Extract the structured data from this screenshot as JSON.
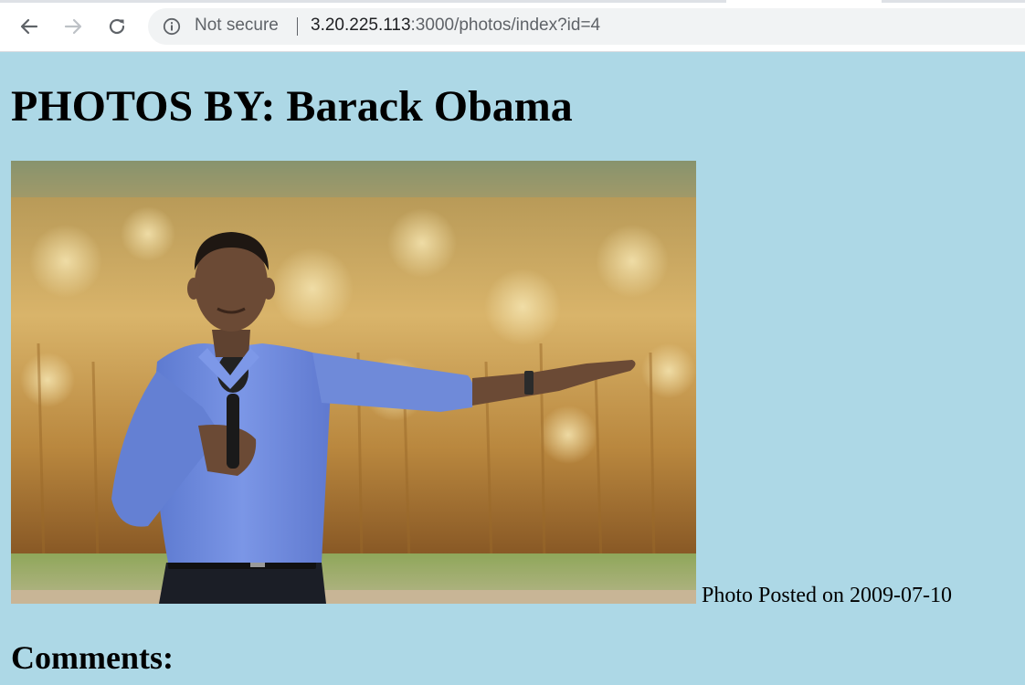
{
  "browser": {
    "security_label": "Not secure",
    "url_host": "3.20.225.113",
    "url_rest": ":3000/photos/index?id=4",
    "back_icon": "arrow-left-icon",
    "forward_icon": "arrow-right-icon",
    "reload_icon": "reload-icon",
    "info_icon": "info-circle-icon"
  },
  "page": {
    "title": "PHOTOS BY: Barack Obama",
    "background_color": "#add8e6",
    "photo": {
      "alt": "Barack Obama speaking into a microphone in front of a cornfield",
      "caption": "Photo Posted on 2009-07-10"
    },
    "comments_heading": "Comments:"
  }
}
